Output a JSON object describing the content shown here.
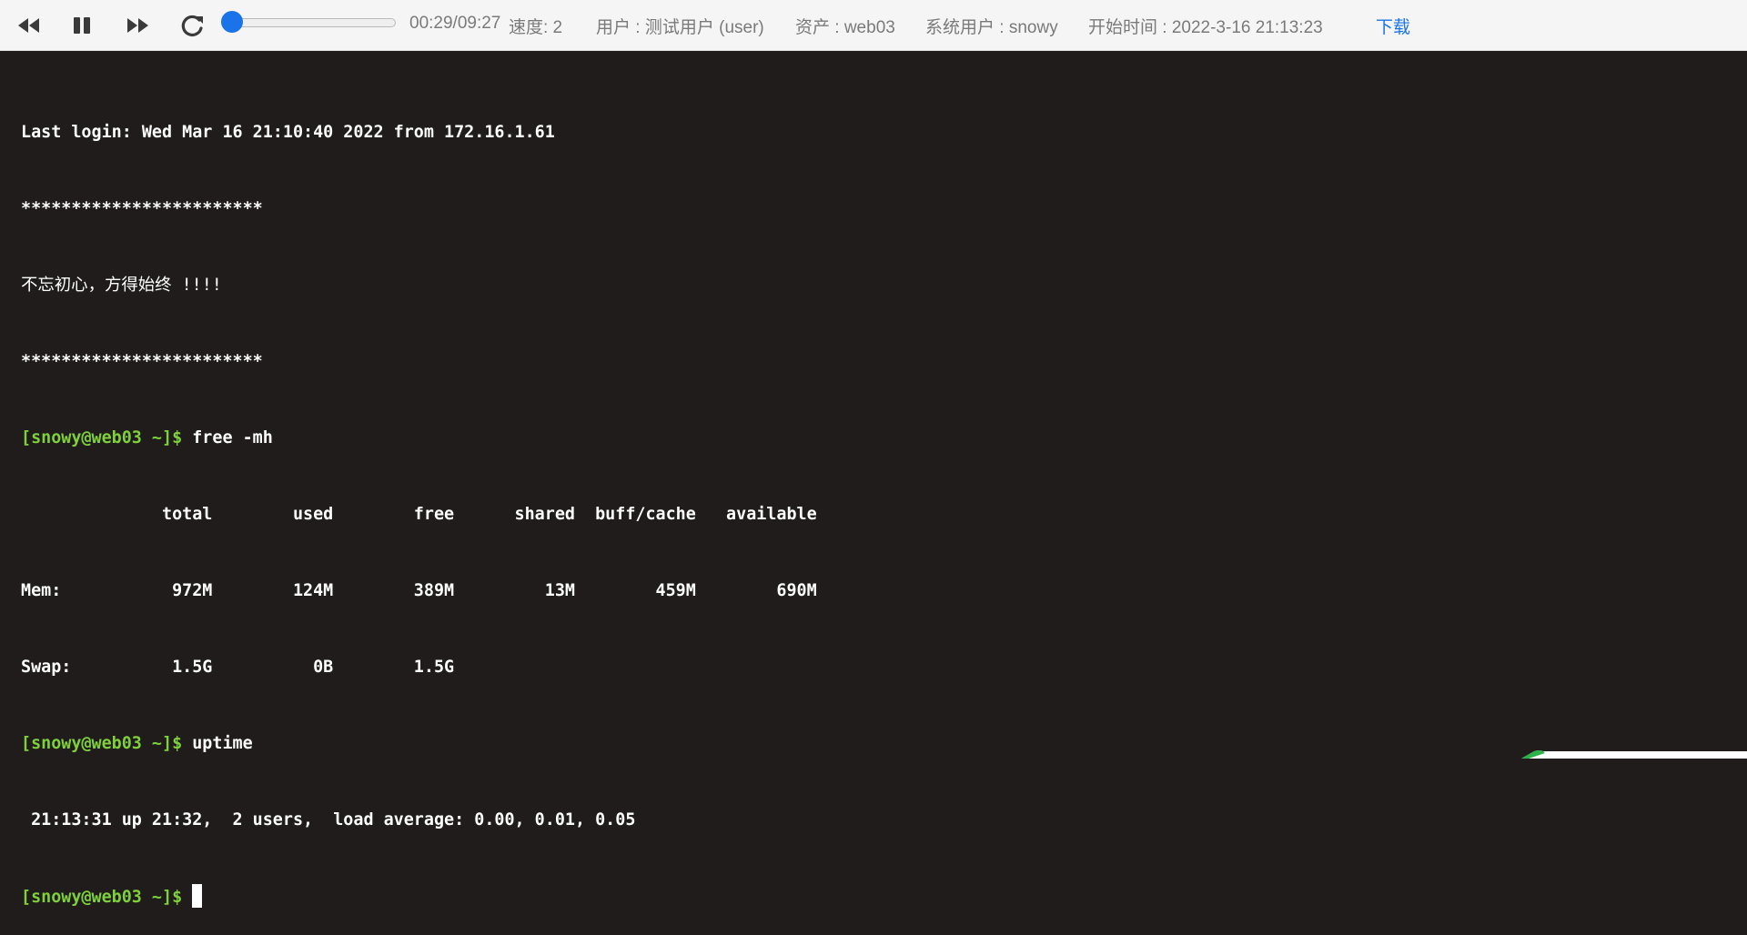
{
  "player": {
    "controls": [
      "rewind-icon",
      "pause-icon",
      "fast-forward-icon",
      "replay-icon"
    ],
    "progress_fraction": 0.05,
    "time": "00:29/09:27",
    "speed": "速度: 2"
  },
  "session": {
    "user": "用户 : 测试用户 (user)",
    "asset": "资产 : web03",
    "system_user": "系统用户 : snowy",
    "start_time": "开始时间 : 2022-3-16 21:13:23",
    "download": "下载"
  },
  "terminal": {
    "lines": {
      "login": "Last login: Wed Mar 16 21:10:40 2022 from 172.16.1.61",
      "stars1": "************************",
      "motto": "不忘初心，方得始终 !!!!",
      "stars2": "************************",
      "cmd1_prompt": "[snowy@web03 ~]$",
      "cmd1": " free -mh",
      "header": "              total        used        free      shared  buff/cache   available",
      "mem": "Mem:           972M        124M        389M         13M        459M        690M",
      "swap": "Swap:          1.5G          0B        1.5G",
      "cmd2_prompt": "[snowy@web03 ~]$",
      "cmd2": " uptime",
      "uptime": " 21:13:31 up 21:32,  2 users,  load average: 0.00, 0.01, 0.05",
      "cmd3_prompt": "[snowy@web03 ~]$",
      "cmd3": " "
    }
  },
  "colors": {
    "prompt": "#7fd13b",
    "background": "#1f1c1b",
    "accent": "#1a73e8"
  }
}
